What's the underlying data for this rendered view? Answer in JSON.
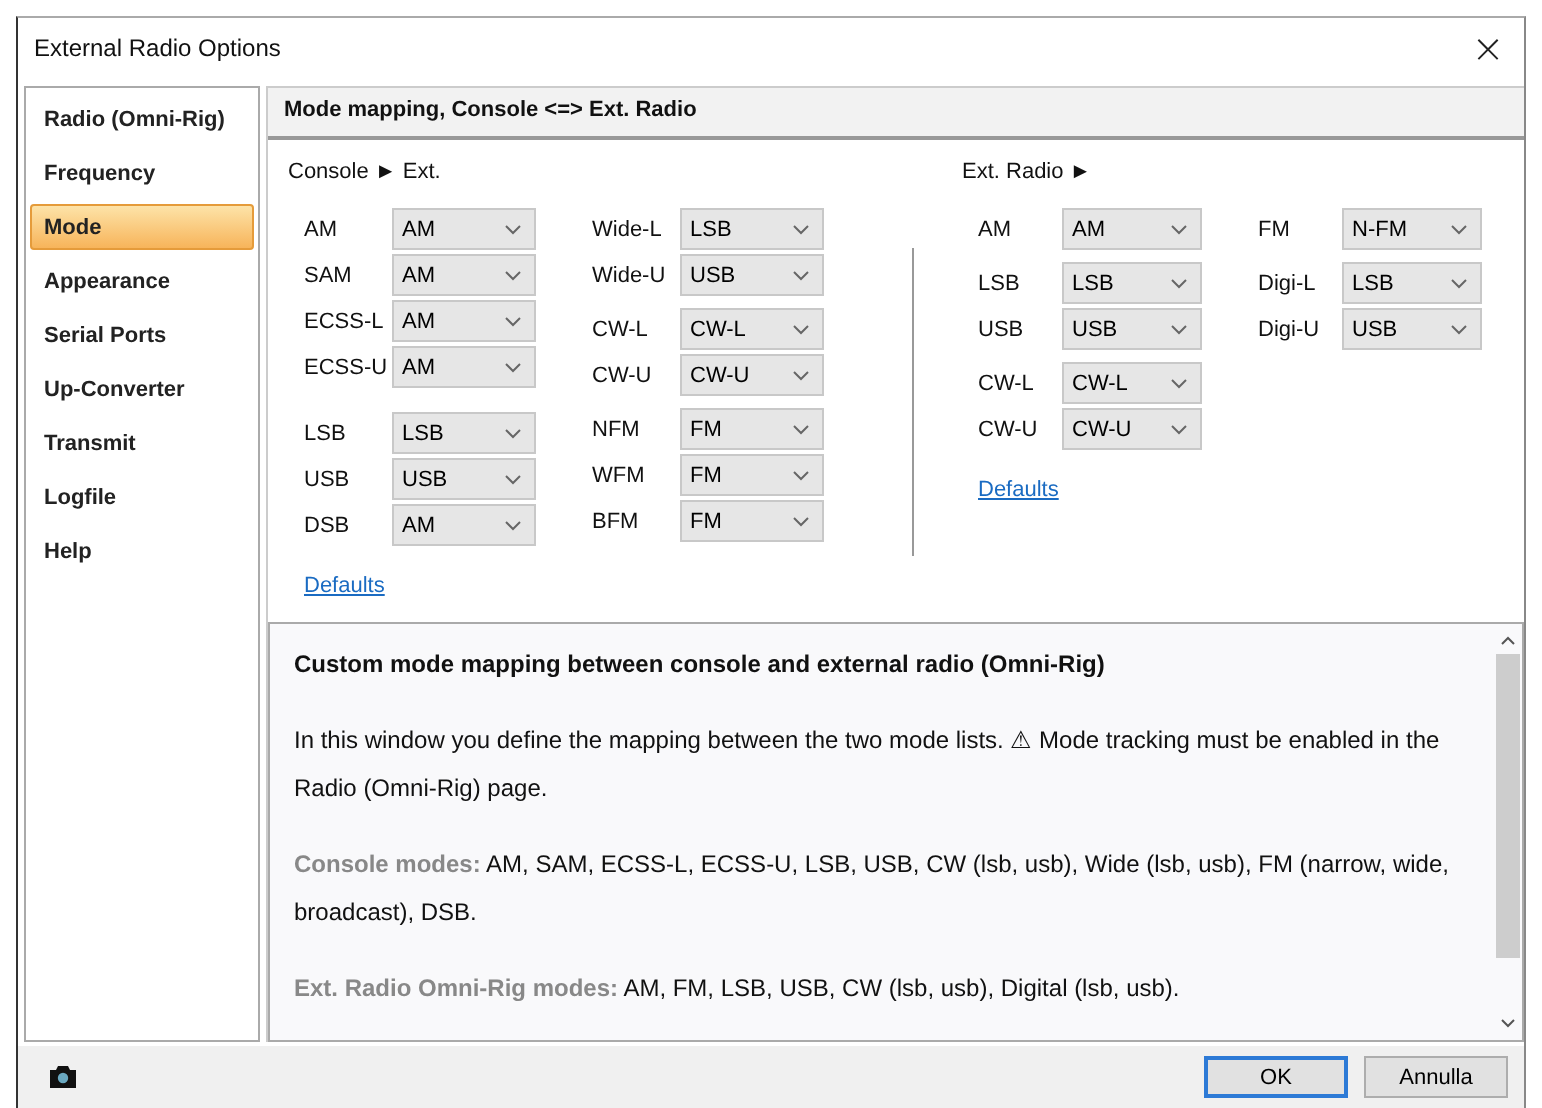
{
  "window": {
    "title": "External Radio Options",
    "close": "×"
  },
  "sidebar": {
    "items": [
      {
        "label": "Radio (Omni-Rig)",
        "selected": false
      },
      {
        "label": "Frequency",
        "selected": false
      },
      {
        "label": "Mode",
        "selected": true
      },
      {
        "label": "Appearance",
        "selected": false
      },
      {
        "label": "Serial Ports",
        "selected": false
      },
      {
        "label": "Up-Converter",
        "selected": false
      },
      {
        "label": "Transmit",
        "selected": false
      },
      {
        "label": "Logfile",
        "selected": false
      },
      {
        "label": "Help",
        "selected": false
      }
    ]
  },
  "header": "Mode mapping, Console <=> Ext. Radio",
  "console": {
    "title": "Console ► Ext.",
    "columns": [
      {
        "groups": [
          [
            {
              "label": "AM",
              "value": "AM"
            },
            {
              "label": "SAM",
              "value": "AM"
            },
            {
              "label": "ECSS-L",
              "value": "AM"
            },
            {
              "label": "ECSS-U",
              "value": "AM"
            }
          ],
          [
            {
              "label": "LSB",
              "value": "LSB"
            },
            {
              "label": "USB",
              "value": "USB"
            },
            {
              "label": "DSB",
              "value": "AM"
            }
          ]
        ]
      },
      {
        "groups": [
          [
            {
              "label": "Wide-L",
              "value": "LSB"
            },
            {
              "label": "Wide-U",
              "value": "USB"
            }
          ],
          [
            {
              "label": "CW-L",
              "value": "CW-L"
            },
            {
              "label": "CW-U",
              "value": "CW-U"
            }
          ],
          [
            {
              "label": "NFM",
              "value": "FM"
            },
            {
              "label": "WFM",
              "value": "FM"
            },
            {
              "label": "BFM",
              "value": "FM"
            }
          ]
        ]
      }
    ],
    "link": "Defaults"
  },
  "ext_radio": {
    "title": "Ext. Radio ►",
    "columns": [
      {
        "groups": [
          [
            {
              "label": "AM",
              "value": "AM"
            }
          ],
          [
            {
              "label": "LSB",
              "value": "LSB"
            },
            {
              "label": "USB",
              "value": "USB"
            }
          ],
          [
            {
              "label": "CW-L",
              "value": "CW-L"
            },
            {
              "label": "CW-U",
              "value": "CW-U"
            }
          ]
        ]
      },
      {
        "groups": [
          [
            {
              "label": "FM",
              "value": "N-FM"
            }
          ],
          [
            {
              "label": "Digi-L",
              "value": "LSB"
            },
            {
              "label": "Digi-U",
              "value": "USB"
            }
          ]
        ]
      }
    ],
    "link": "Defaults"
  },
  "help": {
    "title": "Custom mode mapping between console and external radio (Omni-Rig)",
    "paragraphs": [
      {
        "text": "In this window you define the mapping between the two mode lists. ⚠ Mode tracking must be enabled in the Radio (Omni-Rig) page."
      },
      {
        "label": "Console modes:",
        "text": "AM, SAM, ECSS-L, ECSS-U, LSB, USB, CW (lsb, usb), Wide (lsb, usb), FM (narrow, wide, broadcast), DSB."
      },
      {
        "label": "Ext. Radio Omni-Rig modes:",
        "text": "AM, FM, LSB, USB, CW (lsb, usb), Digital (lsb, usb)."
      }
    ]
  },
  "buttons": [
    {
      "label": "OK",
      "default": true
    },
    {
      "label": "Annulla",
      "default": false
    }
  ]
}
